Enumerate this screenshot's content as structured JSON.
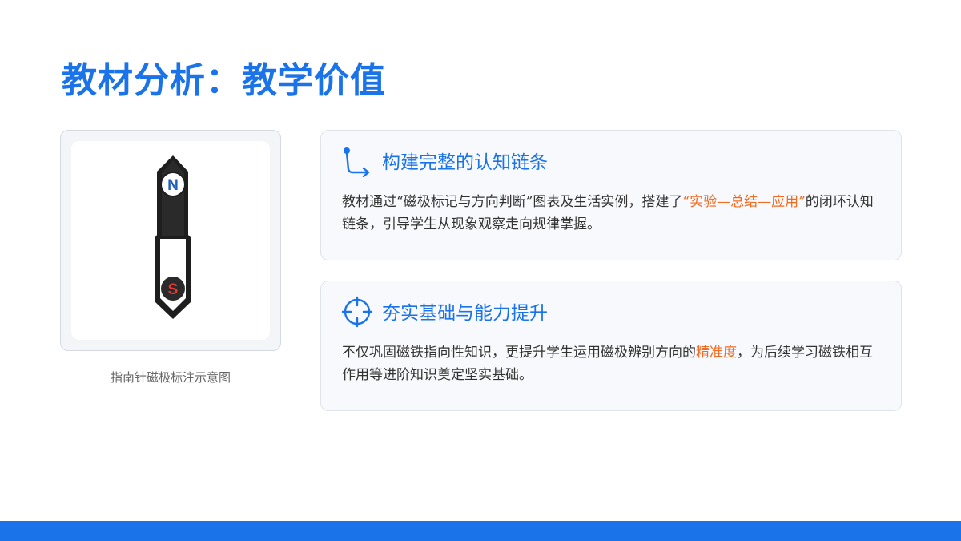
{
  "title": "教材分析：教学价值",
  "figure": {
    "caption": "指南针磁极标注示意图",
    "north_label": "N",
    "south_label": "S"
  },
  "cards": [
    {
      "icon": "route-path-icon",
      "title": "构建完整的认知链条",
      "text_before": "教材通过“磁极标记与方向判断”图表及生活实例，搭建了",
      "highlight": "“实验—总结—应用”",
      "text_after": "的闭环认知链条，引导学生从现象观察走向规律掌握。"
    },
    {
      "icon": "crosshair-target-icon",
      "title": "夯实基础与能力提升",
      "text_before": "不仅巩固磁铁指向性知识，更提升学生运用磁极辨别方向的",
      "highlight": "精准度",
      "text_after": "，为后续学习磁铁相互作用等进阶知识奠定坚实基础。"
    }
  ],
  "colors": {
    "accent": "#1a73e8",
    "highlight": "#f26b21",
    "north_circle": "#1f5fb8",
    "south_circle": "#e53935"
  }
}
